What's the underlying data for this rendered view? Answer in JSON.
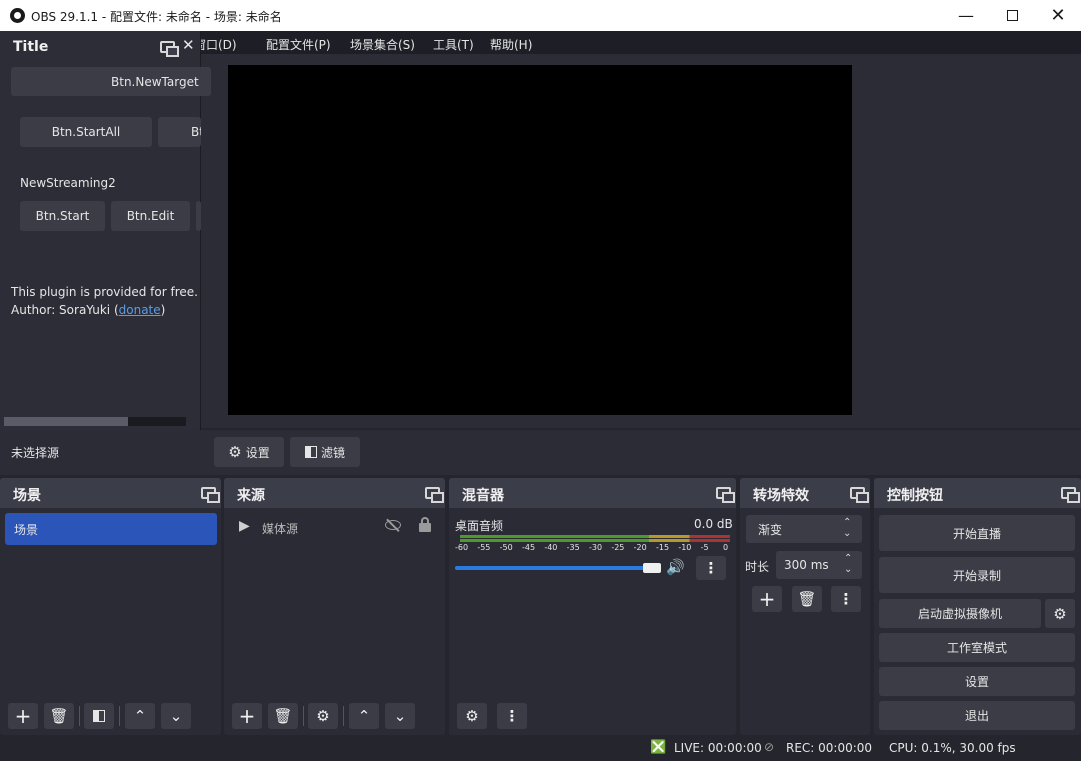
{
  "titlebar": {
    "title": "OBS 29.1.1 - 配置文件: 未命名 - 场景: 未命名"
  },
  "menu": {
    "docks": "停靠窗口(D)",
    "profile": "配置文件(P)",
    "collection": "场景集合(S)",
    "tools": "工具(T)",
    "help": "帮助(H)"
  },
  "plugin_dock": {
    "title": "Title",
    "new_target": "Btn.NewTarget",
    "start_all": "Btn.StartAll",
    "stop_all": "Btn.StopAll",
    "target_name": "NewStreaming2",
    "start": "Btn.Start",
    "edit": "Btn.Edit",
    "free_text": "This plugin is provided for free.",
    "author_prefix": "Author: SoraYuki (",
    "donate": "donate",
    "author_suffix": ")"
  },
  "source_bar": {
    "no_source": "未选择源",
    "properties": "设置",
    "filters": "滤镜"
  },
  "scenes": {
    "title": "场景",
    "items": [
      "场景"
    ]
  },
  "sources": {
    "title": "来源",
    "items": [
      {
        "name": "媒体源"
      }
    ]
  },
  "mixer": {
    "title": "混音器",
    "track_name": "桌面音频",
    "db": "0.0 dB",
    "ticks": [
      "-60",
      "-55",
      "-50",
      "-45",
      "-40",
      "-35",
      "-30",
      "-25",
      "-20",
      "-15",
      "-10",
      "-5",
      "0"
    ],
    "volume": 1.0
  },
  "transitions": {
    "title": "转场特效",
    "selected": "渐变",
    "duration_label": "时长",
    "duration": "300 ms"
  },
  "controls": {
    "title": "控制按钮",
    "start_stream": "开始直播",
    "start_record": "开始录制",
    "virtual_cam": "启动虚拟摄像机",
    "studio_mode": "工作室模式",
    "settings": "设置",
    "exit": "退出"
  },
  "status": {
    "live": "LIVE: 00:00:00",
    "rec": "REC: 00:00:00",
    "cpu": "CPU: 0.1%, 30.00 fps"
  },
  "colors": {
    "accent": "#2b55b8",
    "background": "#24252d",
    "panel": "#2a2b35"
  }
}
